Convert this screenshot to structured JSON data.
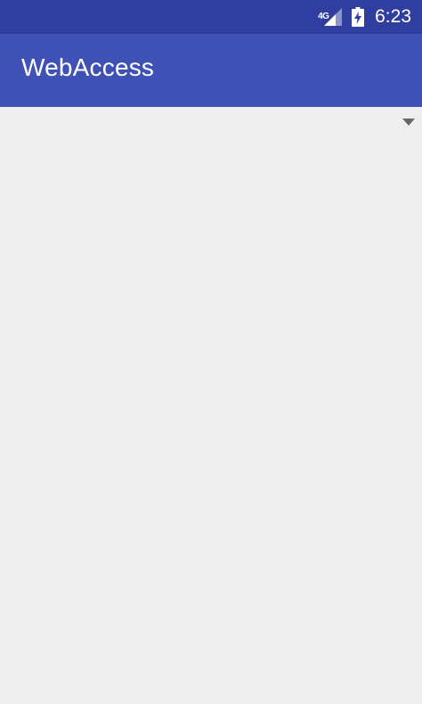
{
  "status_bar": {
    "network_type": "4G",
    "time": "6:23",
    "icons": [
      "signal-icon",
      "battery-charging-icon"
    ]
  },
  "app_bar": {
    "title": "WebAccess"
  },
  "content": {
    "spinner": {
      "icon": "dropdown-arrow-icon"
    }
  },
  "colors": {
    "status_bar": "#303f9f",
    "app_bar": "#3f51b5",
    "background": "#eeeeee",
    "spinner_arrow": "#666666"
  }
}
